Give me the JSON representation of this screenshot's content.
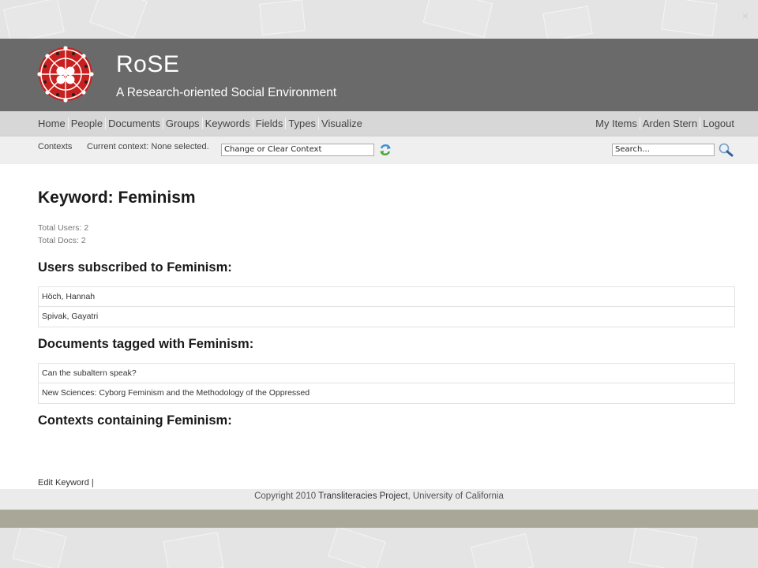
{
  "site": {
    "title": "RoSE",
    "subtitle": "A Research-oriented Social Environment"
  },
  "main_nav": {
    "left": [
      "Home",
      "People",
      "Documents",
      "Groups",
      "Keywords",
      "Fields",
      "Types",
      "Visualize"
    ],
    "right": [
      "My Items",
      "Arden Stern",
      "Logout"
    ]
  },
  "context_bar": {
    "label": "Contexts",
    "current": "Current context: None selected.",
    "context_input_value": "Change or Clear Context",
    "search_input_value": "Search..."
  },
  "keyword": {
    "title": "Keyword: Feminism",
    "total_users": "Total Users: 2",
    "total_docs": "Total Docs: 2"
  },
  "sections": {
    "users_heading": "Users subscribed to Feminism:",
    "users": [
      "Höch, Hannah",
      "Spivak, Gayatri"
    ],
    "docs_heading": "Documents tagged with Feminism:",
    "docs": [
      "Can the subaltern speak?",
      "New Sciences: Cyborg Feminism and the Methodology of the Oppressed"
    ],
    "contexts_heading": "Contexts containing Feminism:"
  },
  "edit_link": "Edit Keyword",
  "edit_sep": "|",
  "footer": {
    "prefix": "Copyright 2010 ",
    "project": "Transliteracies Project",
    "suffix": ", University of California"
  },
  "close_glyph": "×",
  "colors": {
    "header_bg": "#6a6a6a",
    "nav_bg": "#d7d7d7",
    "logo_red": "#c8201e",
    "olive": "#a8a798"
  },
  "icons": [
    "rose-logo-icon",
    "refresh-icon",
    "search-icon",
    "close-icon"
  ]
}
